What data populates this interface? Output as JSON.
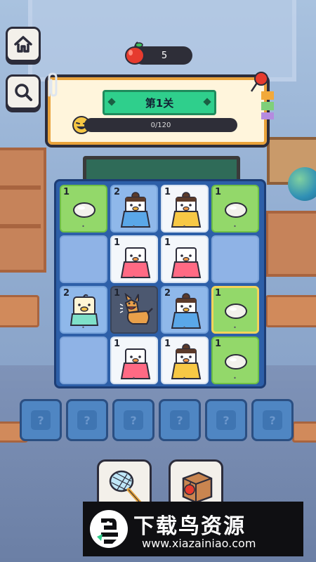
{
  "hud": {
    "apple_count": "5",
    "level_title": "第1关",
    "progress_text": "0/120"
  },
  "board": {
    "tiles": [
      {
        "row": 0,
        "col": 0,
        "num": "1",
        "type": "bun",
        "bg": "green"
      },
      {
        "row": 0,
        "col": 1,
        "num": "2",
        "type": "kid-blue",
        "bg": "blue"
      },
      {
        "row": 0,
        "col": 2,
        "num": "1",
        "type": "kid-yellow",
        "bg": "white"
      },
      {
        "row": 0,
        "col": 3,
        "num": "1",
        "type": "bun",
        "bg": "green"
      },
      {
        "row": 1,
        "col": 0,
        "num": "",
        "type": "empty",
        "bg": "empty"
      },
      {
        "row": 1,
        "col": 1,
        "num": "1",
        "type": "kid-red",
        "bg": "white"
      },
      {
        "row": 1,
        "col": 2,
        "num": "1",
        "type": "kid-red",
        "bg": "white"
      },
      {
        "row": 1,
        "col": 3,
        "num": "",
        "type": "empty",
        "bg": "empty"
      },
      {
        "row": 2,
        "col": 0,
        "num": "2",
        "type": "baby-teal",
        "bg": "blue"
      },
      {
        "row": 2,
        "col": 1,
        "num": "1",
        "type": "dog",
        "bg": "dark"
      },
      {
        "row": 2,
        "col": 2,
        "num": "2",
        "type": "kid-blue",
        "bg": "blue"
      },
      {
        "row": 2,
        "col": 3,
        "num": "1",
        "type": "bun",
        "bg": "green",
        "selected": true
      },
      {
        "row": 3,
        "col": 0,
        "num": "",
        "type": "empty",
        "bg": "empty"
      },
      {
        "row": 3,
        "col": 1,
        "num": "1",
        "type": "kid-red",
        "bg": "white"
      },
      {
        "row": 3,
        "col": 2,
        "num": "1",
        "type": "kid-yellow",
        "bg": "white"
      },
      {
        "row": 3,
        "col": 3,
        "num": "1",
        "type": "bun",
        "bg": "green"
      }
    ]
  },
  "slots": {
    "count": 6,
    "glyph": "?"
  },
  "tools": [
    {
      "name": "net-tool"
    },
    {
      "name": "apple-crate-tool"
    }
  ],
  "watermark": {
    "title": "下载鸟资源",
    "url": "www.xiazainiao.com"
  },
  "colors": {
    "accent_green": "#2fcf8c",
    "board_blue": "#2d5fa8",
    "tile_green": "#93d86a",
    "apple_red": "#e63b2e"
  }
}
